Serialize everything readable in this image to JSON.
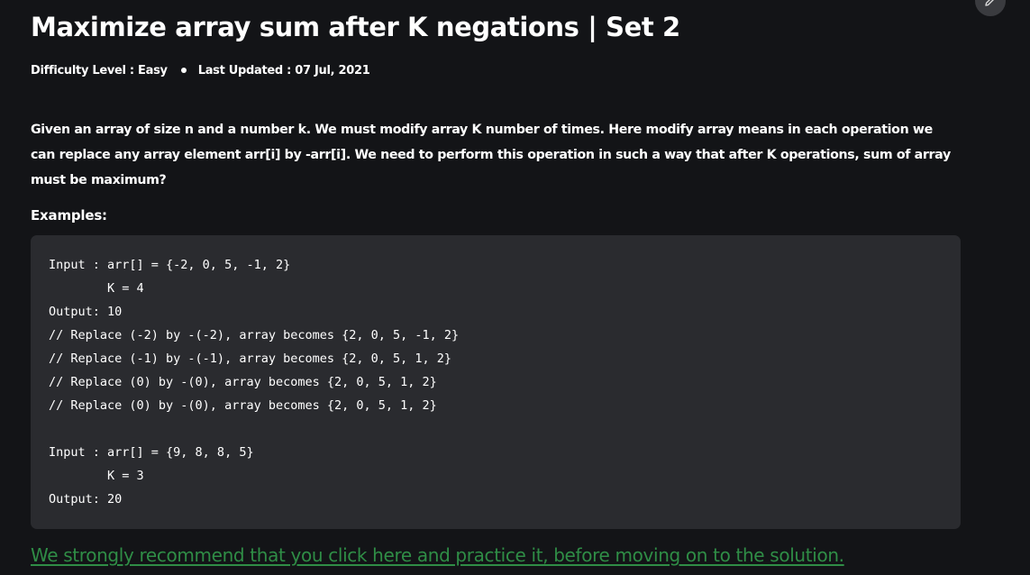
{
  "article": {
    "title": "Maximize array sum after K negations | Set 2",
    "meta": {
      "difficulty": "Difficulty Level : Easy",
      "updated": "Last Updated : 07 Jul, 2021"
    },
    "description": "Given an array of size n and a number k. We must modify array K number of times. Here modify array means in each operation we can replace any array element arr[i] by -arr[i]. We need to perform this operation in such a way that after K operations, sum of array must be maximum?",
    "examples_label": "Examples:",
    "code": "Input : arr[] = {-2, 0, 5, -1, 2}\n        K = 4\nOutput: 10\n// Replace (-2) by -(-2), array becomes {2, 0, 5, -1, 2}\n// Replace (-1) by -(-1), array becomes {2, 0, 5, 1, 2}\n// Replace (0) by -(0), array becomes {2, 0, 5, 1, 2}\n// Replace (0) by -(0), array becomes {2, 0, 5, 1, 2}\n\nInput : arr[] = {9, 8, 8, 5}\n        K = 3\nOutput: 20",
    "practice_link": "We strongly recommend that you click here and practice it, before moving on to the solution."
  },
  "icons": {
    "edit": "pencil-icon"
  },
  "colors": {
    "background": "#131417",
    "code_background": "#2a2b2f",
    "link": "#2f8d46"
  }
}
